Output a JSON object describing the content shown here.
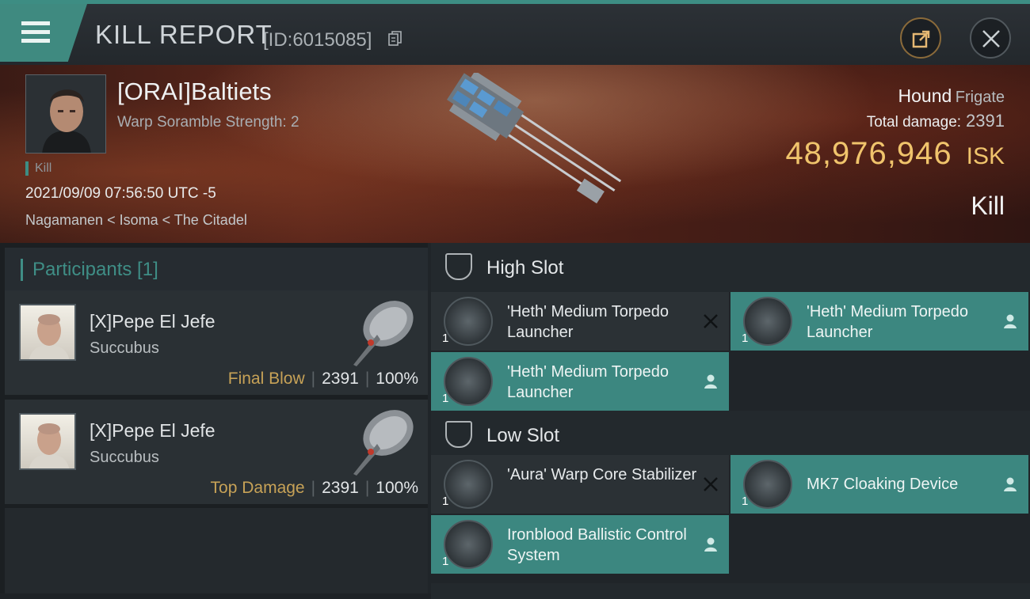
{
  "header": {
    "title": "KILL REPORT",
    "report_id": "[ID:6015085]",
    "icons": {
      "menu": "menu-icon",
      "copy": "copy-icon",
      "share": "share-icon",
      "close": "close-icon"
    }
  },
  "victim": {
    "name": "[ORAI]Baltiets",
    "subtitle": "Warp Soramble Strength: 2",
    "kill_tag": "Kill",
    "datetime": "2021/09/09 07:56:50 UTC -5",
    "location": "Nagamanen < Isoma < The Citadel",
    "ship_name": "Hound",
    "ship_class": "Frigate",
    "total_damage_label": "Total damage:",
    "total_damage": "2391",
    "isk_value": "48,976,946",
    "isk_unit": "ISK",
    "result": "Kill"
  },
  "participants": {
    "header": "Participants [1]",
    "rows": [
      {
        "name": "[X]Pepe El Jefe",
        "ship": "Succubus",
        "tag": "Final Blow",
        "damage": "2391",
        "percent": "100%"
      },
      {
        "name": "[X]Pepe El Jefe",
        "ship": "Succubus",
        "tag": "Top Damage",
        "damage": "2391",
        "percent": "100%"
      }
    ]
  },
  "slots": {
    "high": {
      "label": "High Slot",
      "modules": [
        {
          "name": "'Heth' Medium Torpedo Launcher",
          "qty": "1",
          "state": "destroyed"
        },
        {
          "name": "'Heth' Medium Torpedo Launcher",
          "qty": "1",
          "state": "dropped"
        },
        {
          "name": "'Heth' Medium Torpedo Launcher",
          "qty": "1",
          "state": "dropped"
        }
      ]
    },
    "low": {
      "label": "Low Slot",
      "modules": [
        {
          "name": "'Aura' Warp Core Stabilizer",
          "qty": "1",
          "state": "destroyed"
        },
        {
          "name": "MK7 Cloaking Device",
          "qty": "1",
          "state": "dropped"
        },
        {
          "name": "Ironblood Ballistic Control System",
          "qty": "1",
          "state": "dropped"
        }
      ]
    }
  },
  "colors": {
    "accent": "#3d8d83",
    "isk": "#f0c46c",
    "final_blow": "#c7a257"
  }
}
